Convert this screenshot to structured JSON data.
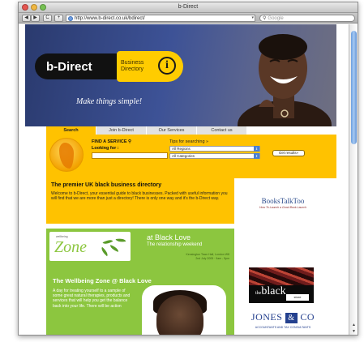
{
  "window": {
    "title": "b-Direct"
  },
  "toolbar": {
    "back": "◀",
    "forward": "▶",
    "reload": "C",
    "add": "+",
    "url": "http://www.b-direct.co.uk/bdirect/",
    "search_placeholder": "Google"
  },
  "hero": {
    "logo_text": "b-Direct",
    "logo_line1": "Business",
    "logo_line2": "Directory",
    "tagline": "Make things simple!"
  },
  "tabs": [
    "Search",
    "Join b-Direct",
    "Our Services",
    "Contact us"
  ],
  "search": {
    "find_label": "FIND A SERVICE",
    "looking_for": "Looking for :",
    "tips": "Tips for searching »",
    "region": "All Regions",
    "category": "All Categories",
    "button": "Get results»"
  },
  "intro": {
    "heading": "The premier UK black business directory",
    "body": "Welcome to b-Direct, your essential guide to black businesses. Packed with useful information you will find that we are more than just a directory! There is only one way and it's the b-Direct way."
  },
  "wellbeing": {
    "logo_top": "wellbeing",
    "logo_word": "Zone",
    "at_black_love": "at Black Love",
    "weekend": "The relationship weekend",
    "venue_line1": "Kensington Town Hall, London W8",
    "venue_line2": "2nd July 2005 · 9am - 5pm",
    "title": "The Wellbeing Zone @ Black Love",
    "text": "A day for treating yourself to a sample of some great natural therapies, products and services that will help you get the balance back into your life. There will be action"
  },
  "ads": {
    "books_title": "BooksTalkToo",
    "books_sub": "How To Launch a Good Book Launch",
    "black_the": "the",
    "black_word": "black",
    "black_store": "store",
    "jones_left": "JONES",
    "jones_amp": "&",
    "jones_right": "CO",
    "jones_sub": "ACCOUNTANTS AND TAX CONSULTANTS"
  },
  "colors": {
    "brand_yellow": "#ffc200",
    "wellbeing_green": "#8cc63f",
    "hero_blue": "#3d5296"
  }
}
